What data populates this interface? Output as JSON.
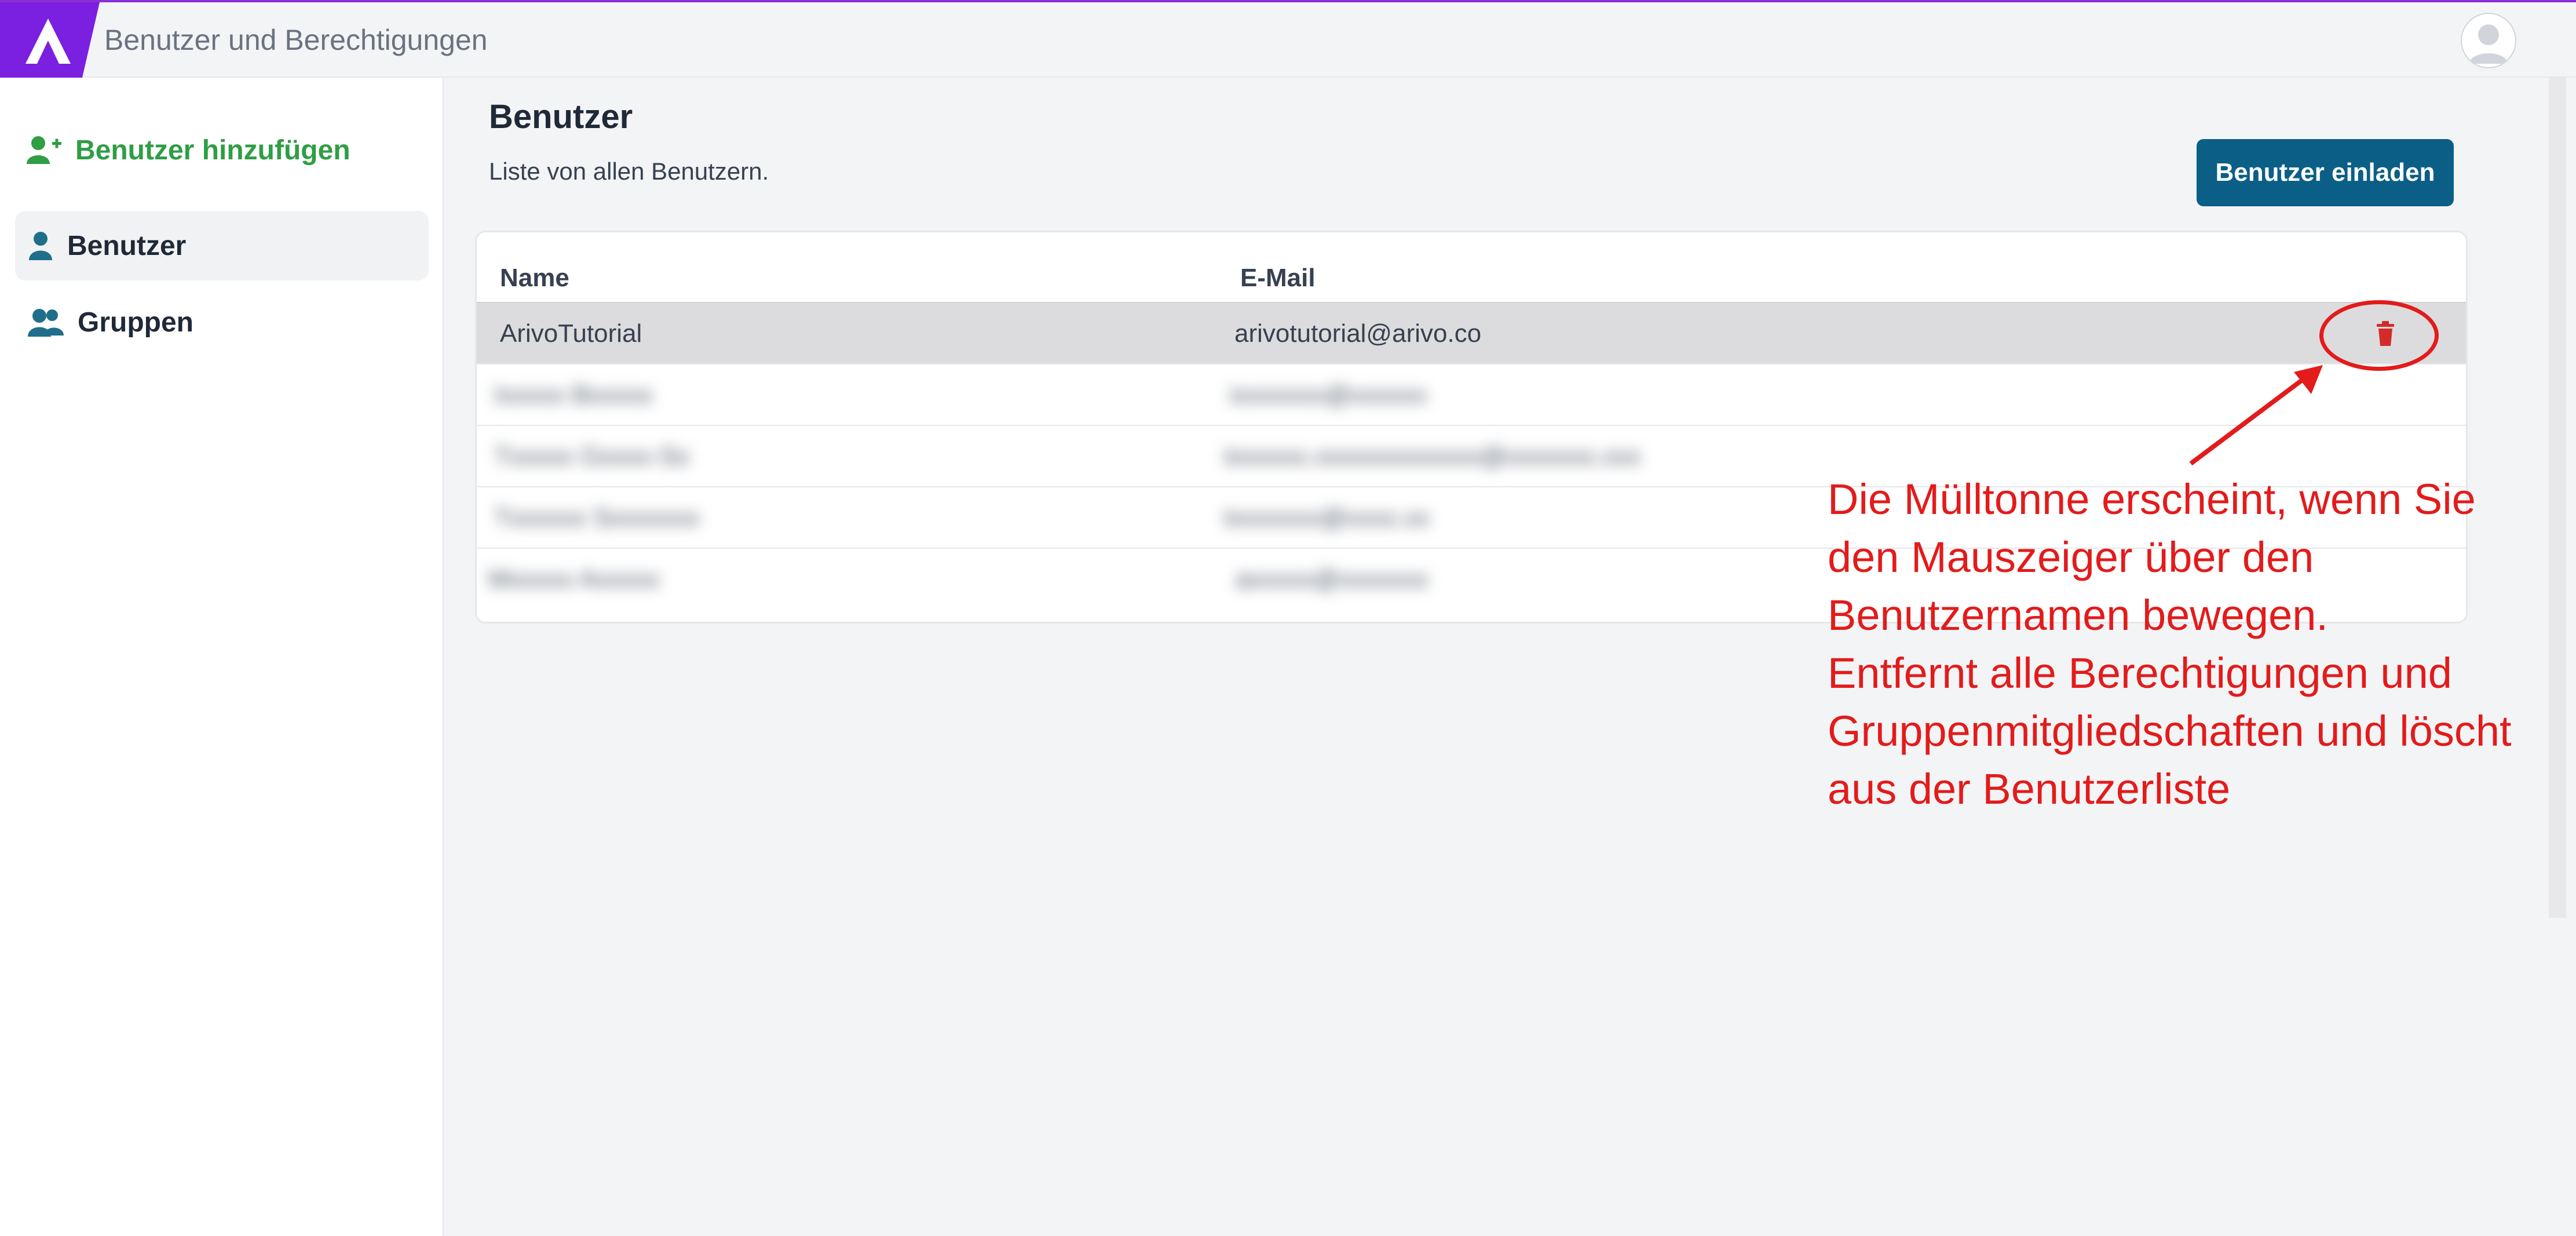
{
  "app": {
    "title": "Benutzer und Berechtigungen"
  },
  "sidebar": {
    "add_user_label": "Benutzer hinzufügen",
    "items": [
      {
        "label": "Benutzer",
        "icon": "user-icon",
        "active": true
      },
      {
        "label": "Gruppen",
        "icon": "users-icon",
        "active": false
      }
    ]
  },
  "main": {
    "title": "Benutzer",
    "subtitle": "Liste von allen Benutzern.",
    "invite_button": "Benutzer einladen",
    "table": {
      "columns": [
        "Name",
        "E-Mail"
      ],
      "rows": [
        {
          "name": "ArivoTutorial",
          "email": "arivotutorial@arivo.co",
          "hovered": true,
          "show_delete": true
        },
        {
          "name": "Ixxxxx Bxxxxx",
          "email": "ixxxxxxx@xxxxxx",
          "blurred": true
        },
        {
          "name": "Txxxxx Gxxxx-Sx",
          "email": "txxxxxx.xxxxxxxxxxxxx@xxxxxxx.xxx",
          "blurred": true
        },
        {
          "name": "Txxxxxx Sxxxxxxx",
          "email": "txxxxxxx@xxxx.xx",
          "blurred": true
        },
        {
          "name": "Mxxxxx Axxxxx",
          "email": "axxxxx@xxxxxxx",
          "blurred": true
        }
      ]
    }
  },
  "annotation": {
    "lines": [
      "Die Mülltonne erscheint, wenn Sie",
      "den Mauszeiger über den",
      "Benutzernamen bewegen.",
      "Entfernt alle Berechtigungen und",
      "Gruppenmitgliedschaften und löscht",
      "aus der Benutzerliste"
    ],
    "color": "#e31b1b"
  },
  "colors": {
    "brand": "#7b1fe0",
    "accent_green": "#2f9e44",
    "primary_button": "#0b5f87",
    "icon_blue": "#1f6f8b",
    "delete_red": "#d42a2a"
  }
}
